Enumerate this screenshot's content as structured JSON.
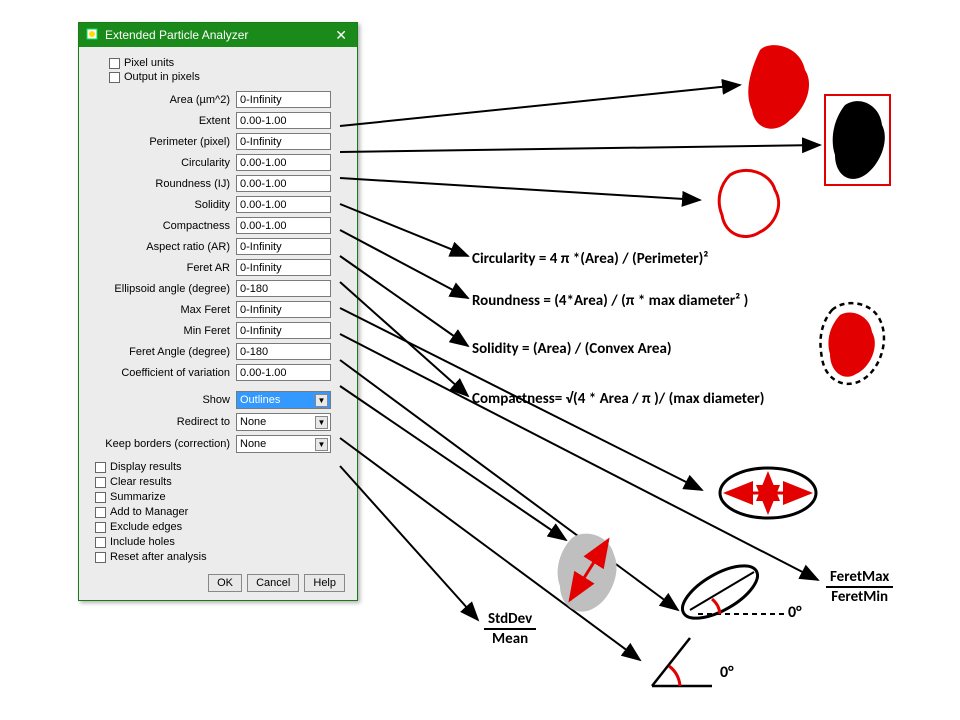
{
  "window": {
    "title": "Extended Particle Analyzer"
  },
  "checks_top": [
    {
      "label": "Pixel units"
    },
    {
      "label": "Output in pixels"
    }
  ],
  "fields": [
    {
      "label": "Area (µm^2)",
      "value": "0-Infinity"
    },
    {
      "label": "Extent",
      "value": "0.00-1.00"
    },
    {
      "label": "Perimeter (pixel)",
      "value": "0-Infinity"
    },
    {
      "label": "Circularity",
      "value": "0.00-1.00"
    },
    {
      "label": "Roundness (IJ)",
      "value": "0.00-1.00"
    },
    {
      "label": "Solidity",
      "value": "0.00-1.00"
    },
    {
      "label": "Compactness",
      "value": "0.00-1.00"
    },
    {
      "label": "Aspect ratio (AR)",
      "value": "0-Infinity"
    },
    {
      "label": "Feret AR",
      "value": "0-Infinity"
    },
    {
      "label": "Ellipsoid angle (degree)",
      "value": "0-180"
    },
    {
      "label": "Max Feret",
      "value": "0-Infinity"
    },
    {
      "label": "Min Feret",
      "value": "0-Infinity"
    },
    {
      "label": "Feret Angle (degree)",
      "value": "0-180"
    },
    {
      "label": "Coefficient of variation",
      "value": "0.00-1.00"
    }
  ],
  "selects": [
    {
      "label": "Show",
      "value": "Outlines",
      "hl": true
    },
    {
      "label": "Redirect to",
      "value": "None",
      "hl": false
    },
    {
      "label": "Keep borders (correction)",
      "value": "None",
      "hl": false
    }
  ],
  "checks_bottom": [
    {
      "label": "Display results"
    },
    {
      "label": "Clear results"
    },
    {
      "label": "Summarize"
    },
    {
      "label": "Add to Manager"
    },
    {
      "label": "Exclude edges"
    },
    {
      "label": "Include holes"
    },
    {
      "label": "Reset after analysis"
    }
  ],
  "buttons": {
    "ok": "OK",
    "cancel": "Cancel",
    "help": "Help"
  },
  "formulas": {
    "circularity": "Circularity   =   4 π *(Area) / (Perimeter)²",
    "roundness": "Roundness =   (4*Area) / (π * max diameter² )",
    "solidity": "Solidity    =   (Area) / (Convex Area)",
    "compactness": "Compactness=   √(4 * Area / π )/ (max diameter)"
  },
  "fractions": {
    "stddev": {
      "num": "StdDev",
      "den": "Mean"
    },
    "feret": {
      "num": "FeretMax",
      "den": "FeretMin"
    }
  },
  "degrees": {
    "zero1": "0°",
    "zero2": "0°"
  }
}
